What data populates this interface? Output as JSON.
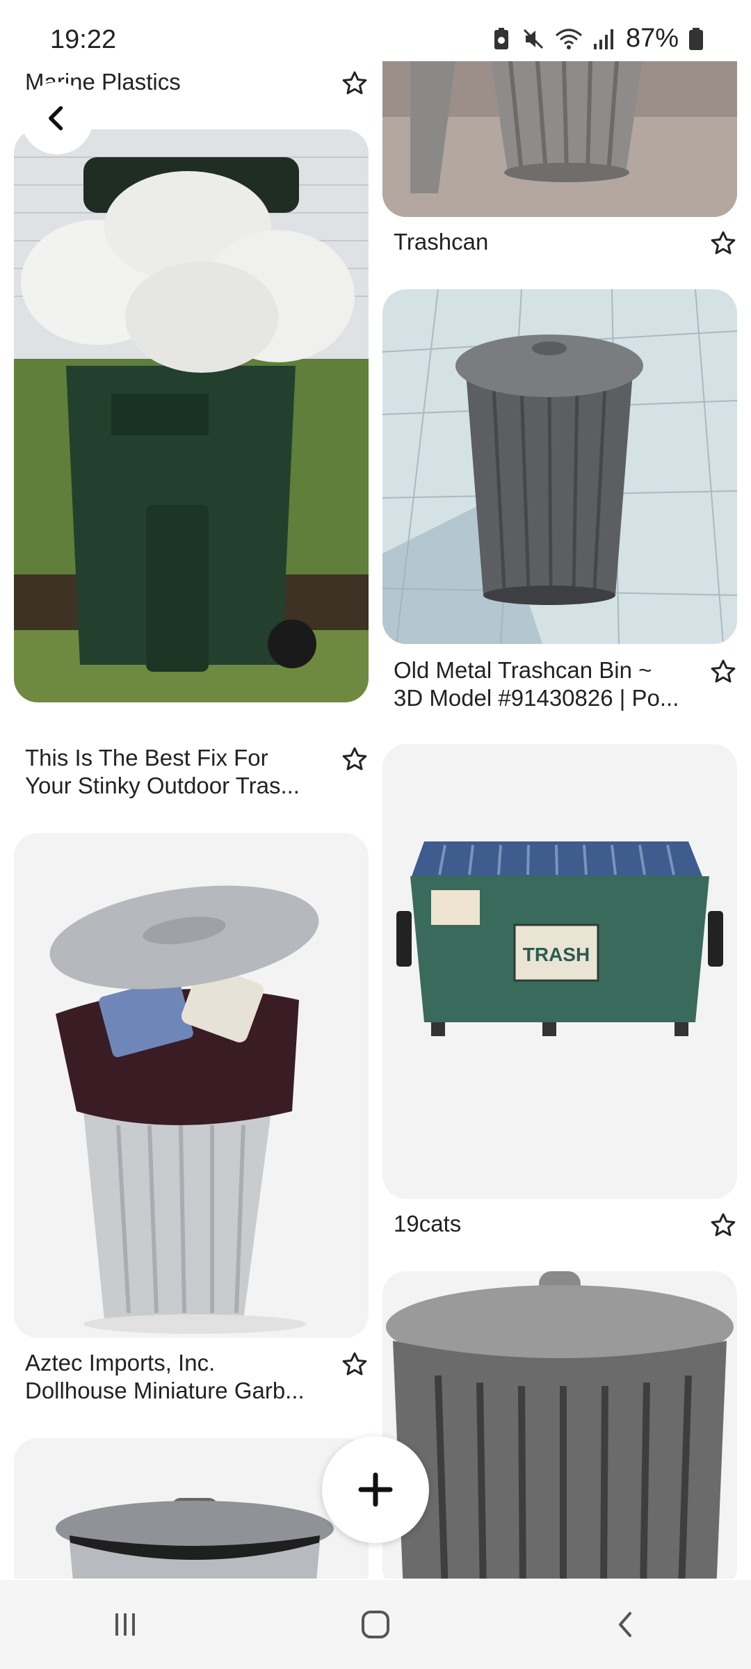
{
  "status": {
    "time": "19:22",
    "battery": "87%"
  },
  "pins": [
    {
      "title_line1": "Marine Plastics",
      "title_line2": ""
    },
    {
      "title_line1": "Trashcan",
      "title_line2": ""
    },
    {
      "title_line1": "This Is The Best Fix For",
      "title_line2": "Your Stinky Outdoor Tras..."
    },
    {
      "title_line1": "Old Metal Trashcan Bin ~",
      "title_line2": "3D Model #91430826 | Po..."
    },
    {
      "title_line1": "19cats",
      "title_line2": ""
    },
    {
      "title_line1": "Aztec Imports, Inc.",
      "title_line2": "Dollhouse Miniature Garb..."
    }
  ],
  "dumpster_label": "TRASH",
  "icons": {
    "back": "chevron-left-icon",
    "save": "star-outline-icon",
    "create": "plus-icon",
    "nav_recents": "recents-icon",
    "nav_home": "home-icon",
    "nav_back": "back-icon"
  },
  "colors": {
    "background": "#ffffff",
    "card_bg": "#f3f3f3",
    "text": "#222222",
    "nav_bar": "#f5f5f5"
  }
}
